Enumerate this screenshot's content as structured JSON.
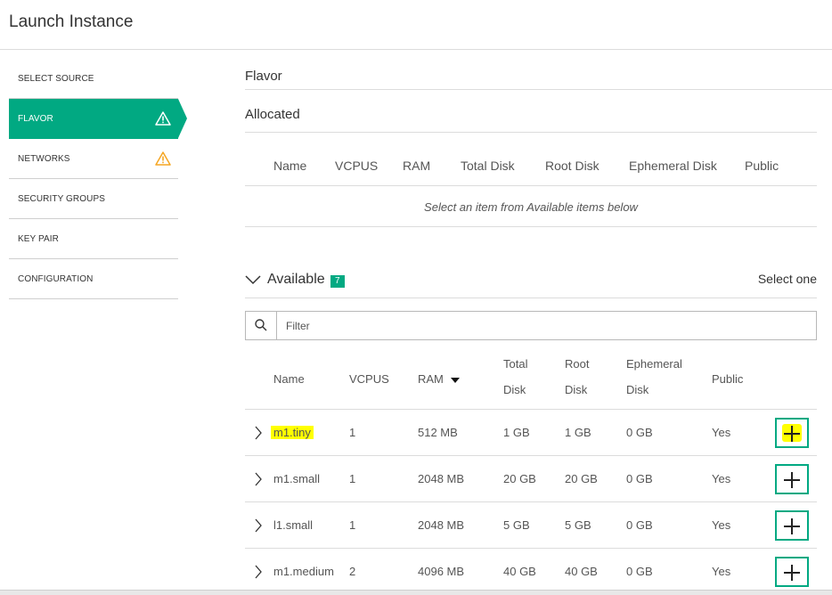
{
  "window": {
    "title": "Launch Instance"
  },
  "sidebar": {
    "items": [
      {
        "label": "SELECT SOURCE",
        "active": false,
        "warning": false
      },
      {
        "label": "FLAVOR",
        "active": true,
        "warning": true
      },
      {
        "label": "NETWORKS",
        "active": false,
        "warning": true
      },
      {
        "label": "SECURITY GROUPS",
        "active": false,
        "warning": false
      },
      {
        "label": "KEY PAIR",
        "active": false,
        "warning": false
      },
      {
        "label": "CONFIGURATION",
        "active": false,
        "warning": false
      }
    ]
  },
  "main": {
    "heading": "Flavor",
    "allocated": {
      "title": "Allocated",
      "columns": [
        "Name",
        "VCPUS",
        "RAM",
        "Total Disk",
        "Root Disk",
        "Ephemeral Disk",
        "Public"
      ],
      "empty_message": "Select an item from Available items below"
    },
    "available": {
      "title": "Available",
      "count": "7",
      "select_hint": "Select one",
      "filter_placeholder": "Filter",
      "columns": {
        "name": "Name",
        "vcpus": "VCPUS",
        "ram": "RAM",
        "total_disk_1": "Total",
        "total_disk_2": "Disk",
        "root_disk_1": "Root",
        "root_disk_2": "Disk",
        "ephemeral_disk_1": "Ephemeral",
        "ephemeral_disk_2": "Disk",
        "public": "Public"
      },
      "rows": [
        {
          "name": "m1.tiny",
          "vcpus": "1",
          "ram": "512 MB",
          "total_disk": "1 GB",
          "root_disk": "1 GB",
          "ephemeral_disk": "0 GB",
          "public": "Yes"
        },
        {
          "name": "m1.small",
          "vcpus": "1",
          "ram": "2048 MB",
          "total_disk": "20 GB",
          "root_disk": "20 GB",
          "ephemeral_disk": "0 GB",
          "public": "Yes"
        },
        {
          "name": "l1.small",
          "vcpus": "1",
          "ram": "2048 MB",
          "total_disk": "5 GB",
          "root_disk": "5 GB",
          "ephemeral_disk": "0 GB",
          "public": "Yes"
        },
        {
          "name": "m1.medium",
          "vcpus": "2",
          "ram": "4096 MB",
          "total_disk": "40 GB",
          "root_disk": "40 GB",
          "ephemeral_disk": "0 GB",
          "public": "Yes"
        }
      ]
    }
  },
  "colors": {
    "accent": "#01a982",
    "warning": "#f5a623",
    "highlight": "#ffff00"
  },
  "icons": {
    "warning": "warning-triangle-icon",
    "search": "search-icon",
    "add": "plus-icon",
    "expand": "chevron-right-icon",
    "collapse": "chevron-down-icon"
  }
}
